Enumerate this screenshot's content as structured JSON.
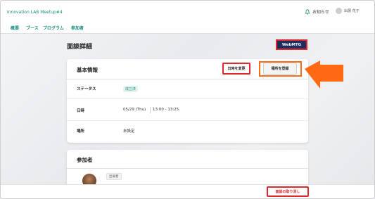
{
  "header": {
    "brand": "Innovation LAB Meetup#4",
    "notice_label": "お知らせ",
    "user_name": "出展 花子"
  },
  "nav": {
    "items": [
      "概要",
      "ブース",
      "プログラム",
      "参加者"
    ]
  },
  "page": {
    "title": "面談詳細",
    "webmtg_button": "WebMTG"
  },
  "basic": {
    "title": "基本情報",
    "change_datetime_button": "日時を変更",
    "register_place_button": "場所を登録",
    "rows": {
      "status_label": "ステータス",
      "status_value": "成立済",
      "datetime_label": "日時",
      "date_value": "05/29 (Thu)",
      "time_value": "13:00 - 13:25",
      "place_label": "場所",
      "place_value": "未設定"
    }
  },
  "participants": {
    "title": "参加者",
    "exhibitor_tag": "出展者"
  },
  "footer": {
    "cancel_button": "面談の取り消し"
  },
  "colors": {
    "accent": "#17907e",
    "navy": "#1f2d5c",
    "highlight_red": "#e0282e",
    "arrow_orange": "#ff6a13"
  }
}
